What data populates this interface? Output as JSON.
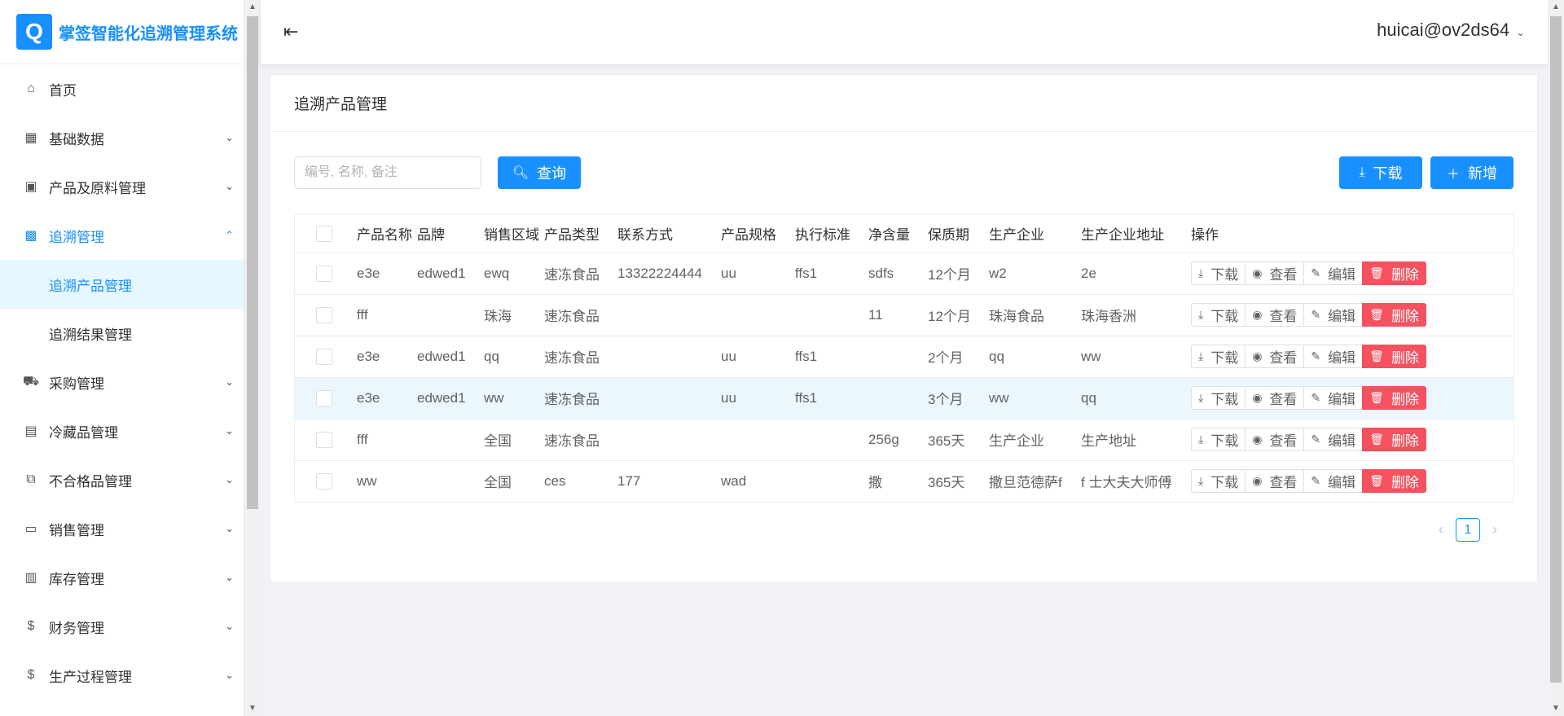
{
  "app": {
    "title": "掌签智能化追溯管理系统",
    "logo_letter": "Q"
  },
  "sidebar": {
    "items": [
      {
        "label": "首页",
        "icon": "home-icon",
        "glyph": "⌂",
        "arrow": ""
      },
      {
        "label": "基础数据",
        "icon": "table-icon",
        "glyph": "▦",
        "arrow": "⌄"
      },
      {
        "label": "产品及原料管理",
        "icon": "grid-icon",
        "glyph": "▣",
        "arrow": "⌄"
      },
      {
        "label": "追溯管理",
        "icon": "qrcode-icon",
        "glyph": "▩",
        "arrow": "⌃"
      },
      {
        "label": "采购管理",
        "icon": "cart-icon",
        "glyph": "⛟",
        "arrow": "⌄"
      },
      {
        "label": "冷藏品管理",
        "icon": "fridge-icon",
        "glyph": "▤",
        "arrow": "⌄"
      },
      {
        "label": "不合格品管理",
        "icon": "block-icon",
        "glyph": "⧉",
        "arrow": "⌄"
      },
      {
        "label": "销售管理",
        "icon": "wallet-icon",
        "glyph": "▭",
        "arrow": "⌄"
      },
      {
        "label": "库存管理",
        "icon": "document-icon",
        "glyph": "▥",
        "arrow": "⌄"
      },
      {
        "label": "财务管理",
        "icon": "dollar-icon",
        "glyph": "$",
        "arrow": "⌄"
      },
      {
        "label": "生产过程管理",
        "icon": "dollar-circle-icon",
        "glyph": "$",
        "arrow": "⌄"
      }
    ],
    "submenu": [
      {
        "label": "追溯产品管理",
        "active": true
      },
      {
        "label": "追溯结果管理",
        "active": false
      }
    ]
  },
  "header": {
    "user": "huicai@ov2ds64"
  },
  "card": {
    "title": "追溯产品管理"
  },
  "toolbar": {
    "search_placeholder": "编号, 名称, 备注",
    "query_label": "查询",
    "download_label": "下载",
    "add_label": "新增"
  },
  "table": {
    "columns": [
      "产品名称",
      "品牌",
      "销售区域",
      "产品类型",
      "联系方式",
      "产品规格",
      "执行标准",
      "净含量",
      "保质期",
      "生产企业",
      "生产企业地址",
      "操作"
    ],
    "rows": [
      [
        "e3e",
        "edwed1",
        "ewq",
        "速冻食品",
        "13322224444",
        "uu",
        "ffs1",
        "sdfs",
        "12个月",
        "w2",
        "2e"
      ],
      [
        "fff",
        "",
        "珠海",
        "速冻食品",
        "",
        "",
        "",
        "11",
        "12个月",
        "珠海食品",
        "珠海香洲"
      ],
      [
        "e3e",
        "edwed1",
        "qq",
        "速冻食品",
        "",
        "uu",
        "ffs1",
        "",
        "2个月",
        "qq",
        "ww"
      ],
      [
        "e3e",
        "edwed1",
        "ww",
        "速冻食品",
        "",
        "uu",
        "ffs1",
        "",
        "3个月",
        "ww",
        "qq"
      ],
      [
        "fff",
        "",
        "全国",
        "速冻食品",
        "",
        "",
        "",
        "256g",
        "365天",
        "生产企业",
        "生产地址"
      ],
      [
        "ww",
        "",
        "全国",
        "ces",
        "177",
        "wad",
        "",
        "撒",
        "365天",
        "撒旦范德萨f",
        "f 士大夫大师傅"
      ]
    ],
    "highlight_row": 3,
    "actions": {
      "download": "下载",
      "view": "查看",
      "edit": "编辑",
      "delete": "删除"
    }
  },
  "pagination": {
    "current": "1"
  },
  "colors": {
    "primary": "#1890ff",
    "danger": "#f5515f",
    "active_bg": "#e6f7ff"
  }
}
